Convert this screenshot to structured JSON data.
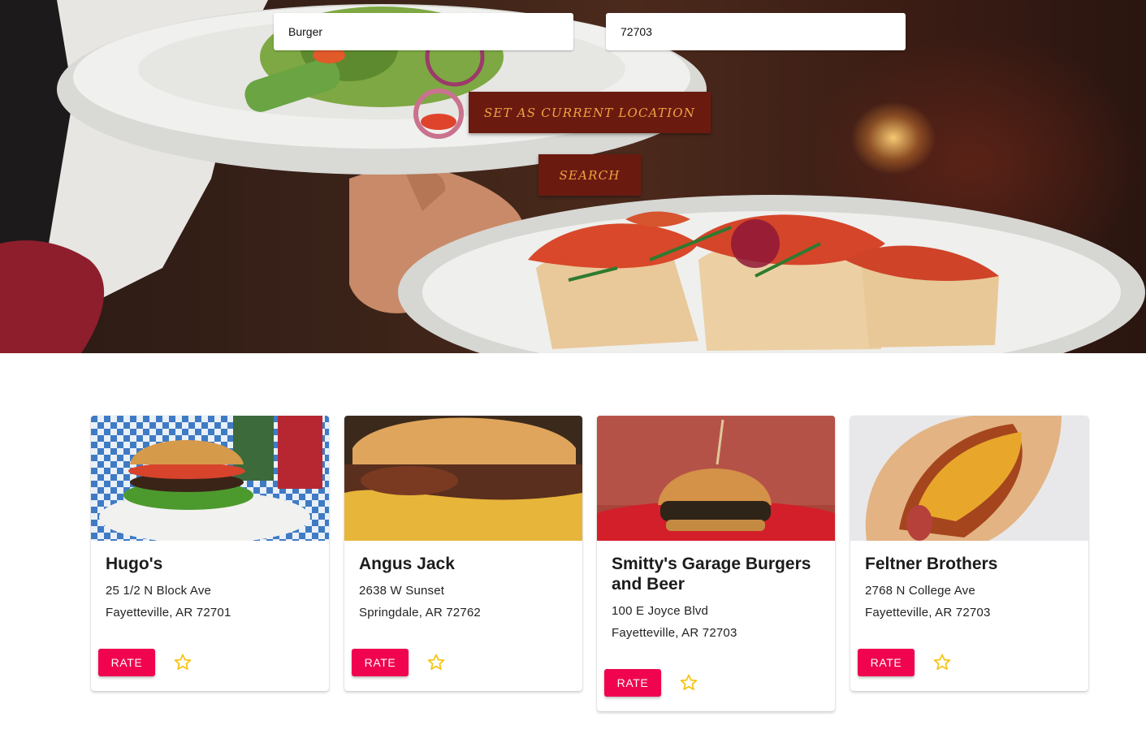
{
  "search": {
    "term_value": "Burger",
    "location_value": "72703",
    "set_location_label": "Set as current location",
    "search_label": "Search"
  },
  "colors": {
    "hero_button_bg": "#6b1a10",
    "hero_button_text": "#f1a340",
    "rate_button": "#f0034f",
    "star": "#f5c518"
  },
  "restaurants": [
    {
      "name": "Hugo's",
      "address": "25 1/2 N Block Ave",
      "city": "Fayetteville, AR 72701",
      "rate_label": "RATE",
      "favorite_icon": "star-outline-icon"
    },
    {
      "name": "Angus Jack",
      "address": "2638 W Sunset",
      "city": "Springdale, AR 72762",
      "rate_label": "RATE",
      "favorite_icon": "star-outline-icon"
    },
    {
      "name": "Smitty's Garage Burgers and Beer",
      "address": "100 E Joyce Blvd",
      "city": "Fayetteville, AR 72703",
      "rate_label": "RATE",
      "favorite_icon": "star-outline-icon"
    },
    {
      "name": "Feltner Brothers",
      "address": "2768 N College Ave",
      "city": "Fayetteville, AR 72703",
      "rate_label": "RATE",
      "favorite_icon": "star-outline-icon"
    }
  ]
}
